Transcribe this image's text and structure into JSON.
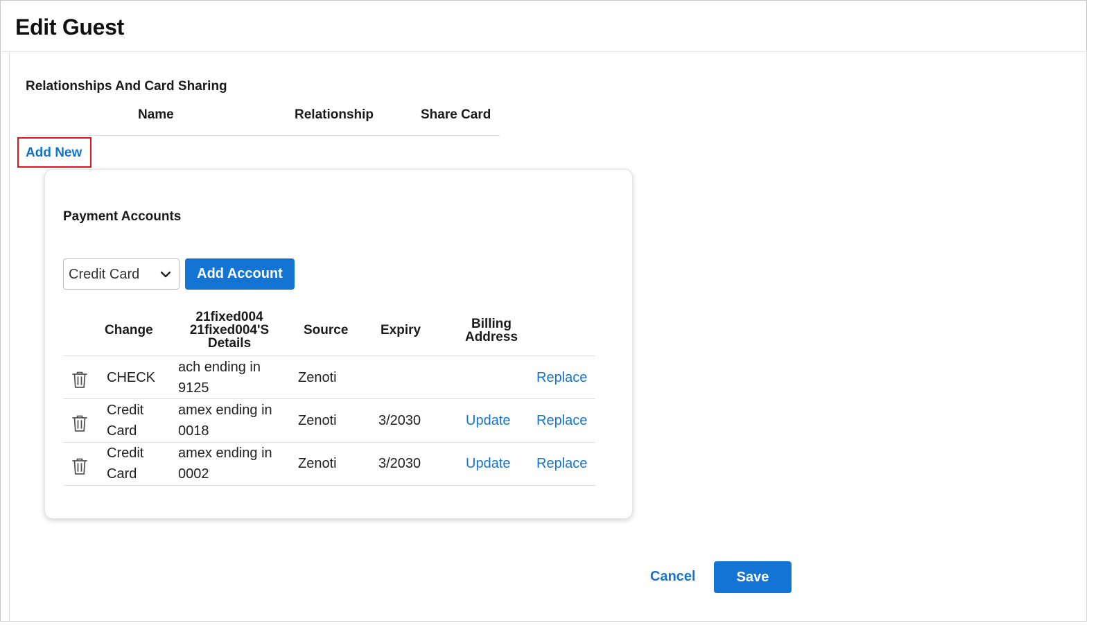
{
  "header": {
    "title": "Edit Guest"
  },
  "relationships": {
    "section_title": "Relationships And Card Sharing",
    "columns": [
      "Name",
      "Relationship",
      "Share Card"
    ],
    "add_new_label": "Add New"
  },
  "payment_accounts": {
    "title": "Payment Accounts",
    "account_type_select": {
      "value": "Credit Card"
    },
    "add_account_label": "Add Account",
    "columns": {
      "change": "Change",
      "details_line1": "21fixed004",
      "details_line2": "21fixed004'S",
      "details_line3": "Details",
      "source": "Source",
      "expiry": "Expiry",
      "billing_line1": "Billing",
      "billing_line2": "Address"
    },
    "rows": [
      {
        "change_line1": "CHECK",
        "change_line2": "",
        "details_line1": "ach ending in",
        "details_line2": "9125",
        "source": "Zenoti",
        "expiry": "",
        "update": "",
        "replace": "Replace"
      },
      {
        "change_line1": "Credit",
        "change_line2": "Card",
        "details_line1": "amex ending in",
        "details_line2": "0018",
        "source": "Zenoti",
        "expiry": "3/2030",
        "update": "Update",
        "replace": "Replace"
      },
      {
        "change_line1": "Credit",
        "change_line2": "Card",
        "details_line1": "amex ending in",
        "details_line2": "0002",
        "source": "Zenoti",
        "expiry": "3/2030",
        "update": "Update",
        "replace": "Replace"
      }
    ]
  },
  "footer": {
    "cancel_label": "Cancel",
    "save_label": "Save"
  },
  "colors": {
    "accent": "#1474d4",
    "link": "#1474cc",
    "highlight_border": "#e0131a"
  },
  "icons": {
    "row_delete": "trash-icon",
    "select_caret": "chevron-down-icon"
  }
}
